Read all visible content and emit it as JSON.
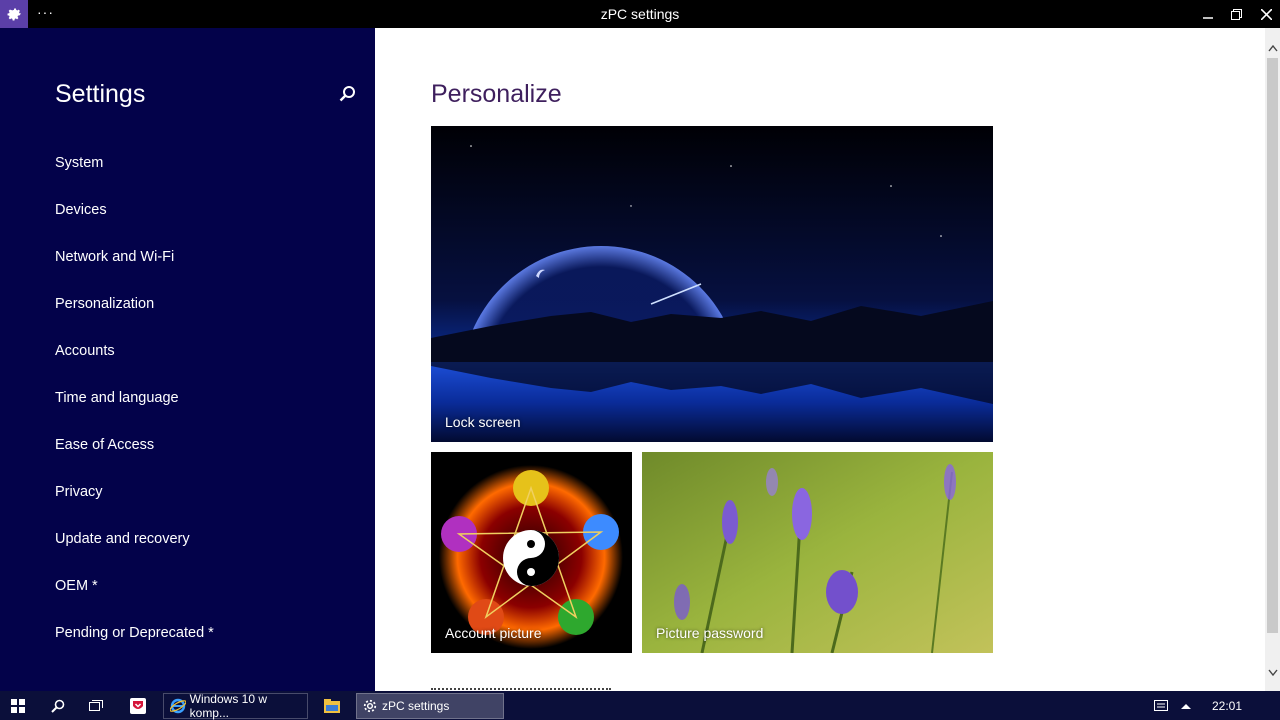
{
  "window": {
    "title": "zPC settings",
    "menu_dots": "···",
    "app_icon": "gear-icon",
    "controls": {
      "minimize": "minimize-icon",
      "restore": "restore-icon",
      "close": "close-icon"
    }
  },
  "sidebar": {
    "heading": "Settings",
    "search_icon": "search-icon",
    "items": [
      {
        "label": "System"
      },
      {
        "label": "Devices"
      },
      {
        "label": "Network and Wi-Fi"
      },
      {
        "label": "Personalization"
      },
      {
        "label": "Accounts"
      },
      {
        "label": "Time and language"
      },
      {
        "label": "Ease of Access"
      },
      {
        "label": "Privacy"
      },
      {
        "label": "Update and recovery"
      },
      {
        "label": "OEM *"
      },
      {
        "label": "Pending or Deprecated *"
      }
    ]
  },
  "main": {
    "title": "Personalize",
    "tiles": {
      "lock_screen": "Lock screen",
      "account_picture": "Account picture",
      "picture_password": "Picture password"
    }
  },
  "taskbar": {
    "apps": {
      "browser": "Windows 10 w komp...",
      "settings": "zPC settings"
    },
    "clock": "22:01"
  },
  "colors": {
    "sidebar_bg": "#03024a",
    "title_color": "#3e1f5d",
    "accent": "#5b3fa8"
  }
}
